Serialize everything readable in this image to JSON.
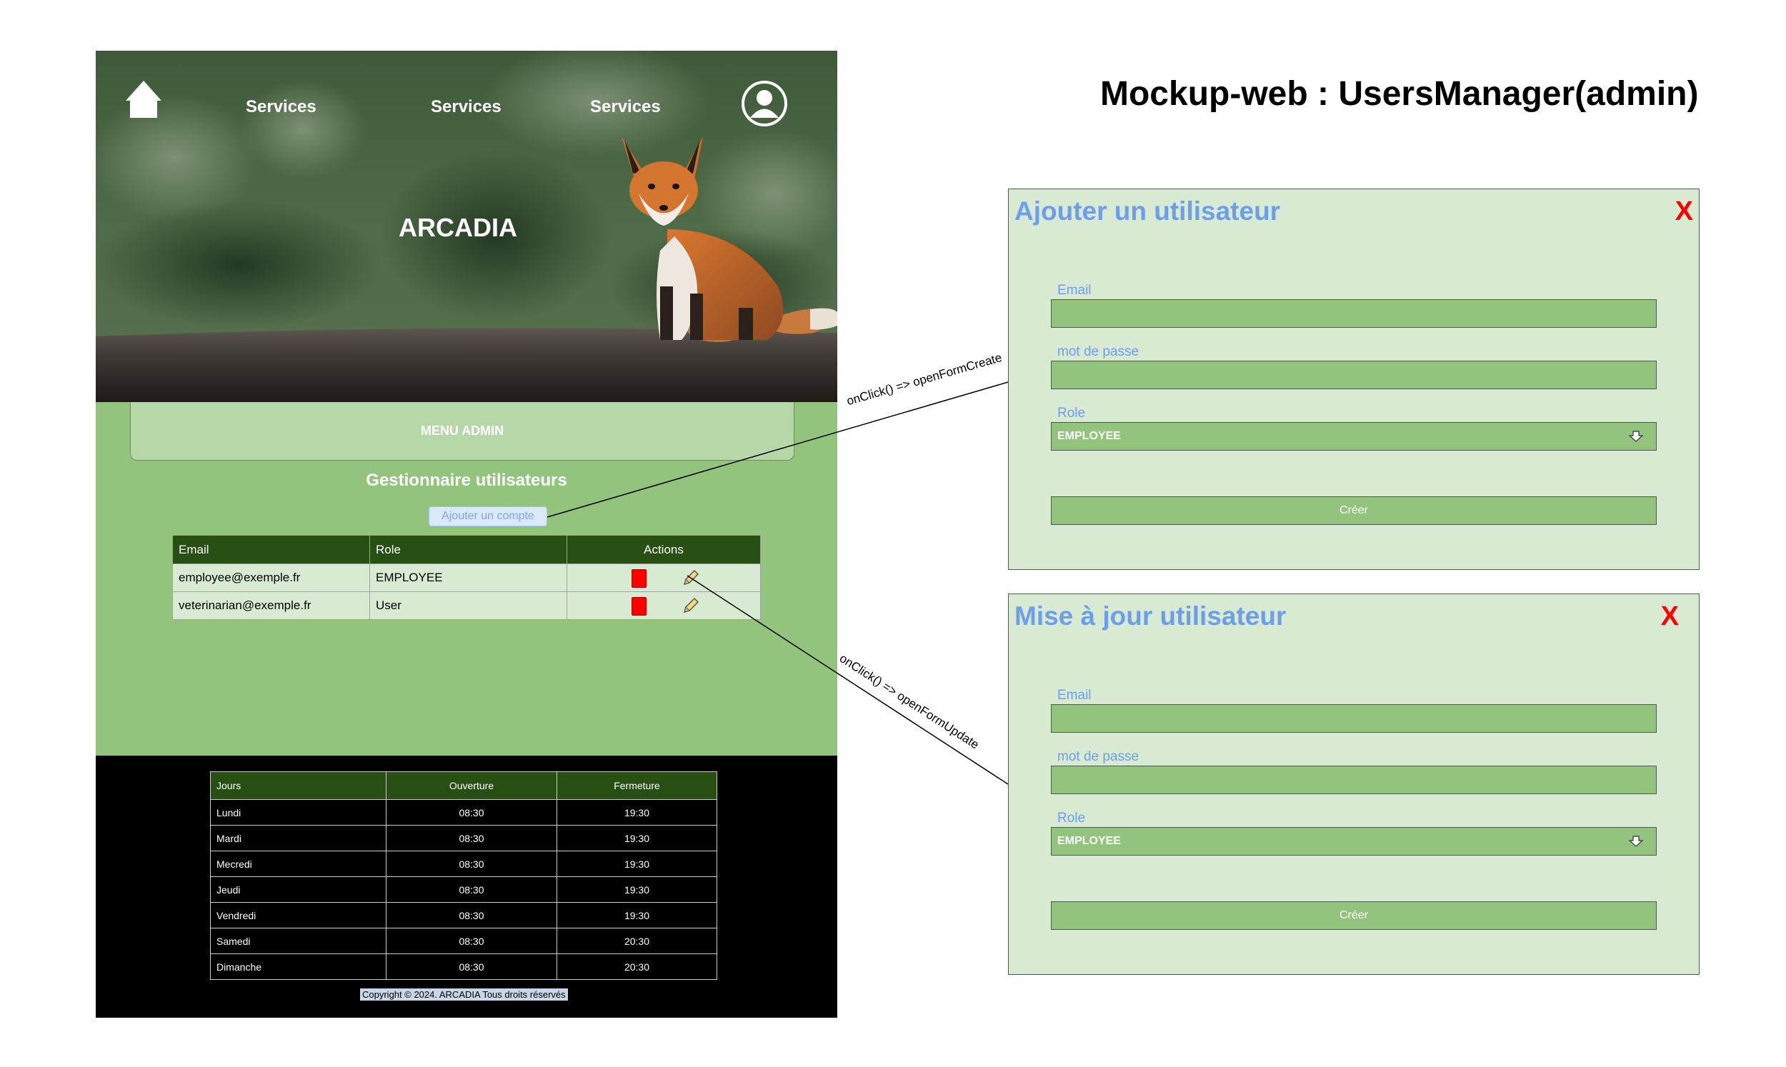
{
  "page_title": "Mockup-web : UsersManager(admin)",
  "mockup": {
    "nav": {
      "links": [
        "Services",
        "Services",
        "Services"
      ],
      "home_icon": "home-icon",
      "user_icon": "user-account-icon"
    },
    "hero_title": "ARCADIA",
    "menu_admin": "MENU ADMIN",
    "section_title": "Gestionnaire utilisateurs",
    "add_account_label": "Ajouter un compte",
    "user_table": {
      "headers": [
        "Email",
        "Role",
        "Actions"
      ],
      "rows": [
        {
          "email": "employee@exemple.fr",
          "role": "EMPLOYEE"
        },
        {
          "email": "veterinarian@exemple.fr",
          "role": "User"
        }
      ],
      "delete_icon": "delete-icon",
      "edit_icon": "pencil-icon"
    },
    "hours_table": {
      "headers": [
        "Jours",
        "Ouverture",
        "Fermeture"
      ],
      "rows": [
        [
          "Lundi",
          "08:30",
          "19:30"
        ],
        [
          "Mardi",
          "08:30",
          "19:30"
        ],
        [
          "Mecredi",
          "08:30",
          "19:30"
        ],
        [
          "Jeudi",
          "08:30",
          "19:30"
        ],
        [
          "Vendredi",
          "08:30",
          "19:30"
        ],
        [
          "Samedi",
          "08:30",
          "20:30"
        ],
        [
          "Dimanche",
          "08:30",
          "20:30"
        ]
      ]
    },
    "copyright": "Copyright © 2024. ARCADIA Tous droits réservés"
  },
  "connectors": {
    "create": "onClick() => openFormCreate",
    "update": "onClick() => openFormUpdate"
  },
  "create_form": {
    "title": "Ajouter un utilisateur",
    "close": "X",
    "email_label": "Email",
    "password_label": "mot de passe",
    "role_label": "Role",
    "role_value": "EMPLOYEE",
    "submit": "Créer"
  },
  "update_form": {
    "title": "Mise à jour utilisateur",
    "close": "X",
    "email_label": "Email",
    "password_label": "mot de passe",
    "role_label": "Role",
    "role_value": "EMPLOYEE",
    "submit": "Créer"
  },
  "colors": {
    "green_dark": "#274e13",
    "green_mid": "#93c47d",
    "green_light": "#d9ead3",
    "title_blue": "#6d9eeb",
    "close_red": "#ff0000"
  }
}
